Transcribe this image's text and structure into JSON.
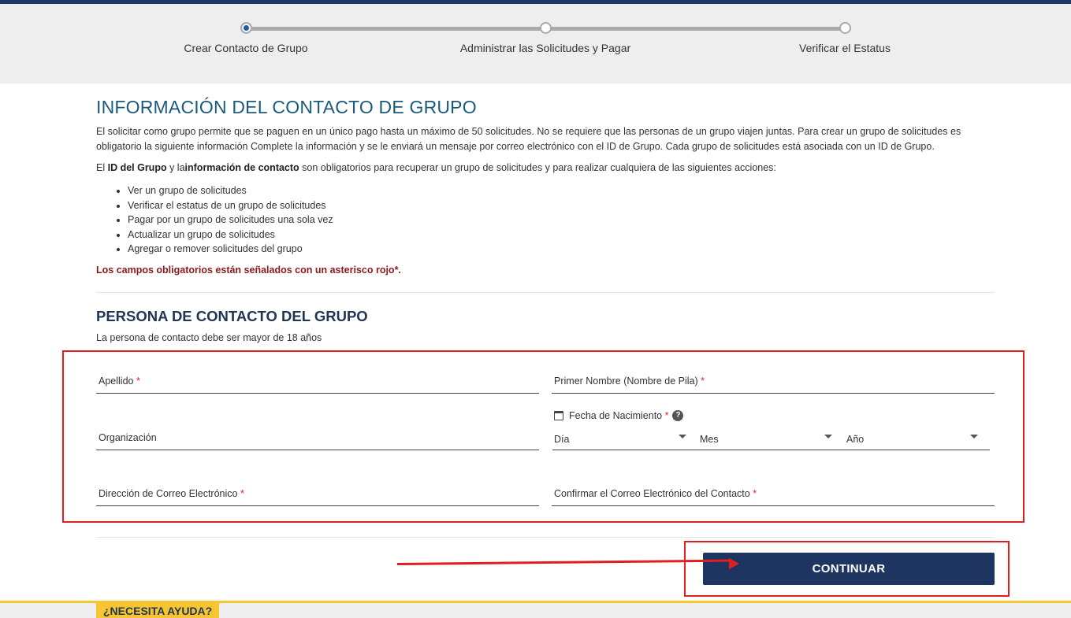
{
  "stepper": {
    "steps": [
      {
        "label": "Crear Contacto de Grupo",
        "active": true
      },
      {
        "label": "Administrar las Solicitudes y Pagar",
        "active": false
      },
      {
        "label": "Verificar el Estatus",
        "active": false
      }
    ]
  },
  "page": {
    "title": "INFORMACIÓN DEL CONTACTO DE GRUPO",
    "intro": "El solicitar como grupo permite que se paguen en un único pago hasta un máximo de 50 solicitudes. No se requiere que las personas de un grupo viajen juntas. Para crear un grupo de solicitudes es obligatorio la siguiente información Complete la información y se le enviará un mensaje por correo electrónico con el ID de Grupo. Cada grupo de solicitudes está asociada con un ID de Grupo.",
    "req_prefix": "El ",
    "req_bold1": "ID del Grupo",
    "req_mid": " y la",
    "req_bold2": "información de contacto",
    "req_suffix": " son obligatorios para recuperar un grupo de solicitudes y para realizar cualquiera de las siguientes acciones:",
    "actions": [
      "Ver un grupo de solicitudes",
      "Verificar el estatus de un grupo de solicitudes",
      "Pagar por un grupo de solicitudes una sola vez",
      "Actualizar un grupo de solicitudes",
      "Agregar o remover solicitudes del grupo"
    ],
    "required_note": "Los campos obligatorios están señalados con un asterisco rojo*."
  },
  "contact_section": {
    "heading": "PERSONA DE CONTACTO DEL GRUPO",
    "age_note": "La persona de contacto debe ser mayor de 18 años"
  },
  "form": {
    "required_mark": "*",
    "last_name_label": "Apellido",
    "first_name_label": "Primer Nombre (Nombre de Pila)",
    "organization_label": "Organización",
    "dob_label": "Fecha de Nacimiento",
    "dob_help": "?",
    "day_label": "Día",
    "month_label": "Mes",
    "year_label": "Año",
    "email_label": "Dirección de Correo Electrónico",
    "confirm_email_label": "Confirmar el Correo Electrónico del Contacto"
  },
  "actions_bar": {
    "continue_label": "CONTINUAR"
  },
  "footer": {
    "help_tab": "¿NECESITA AYUDA?"
  },
  "colors": {
    "title": "#1a5a7d",
    "button": "#1d3560",
    "annotation": "#e02020",
    "help_tab": "#f7c531"
  }
}
